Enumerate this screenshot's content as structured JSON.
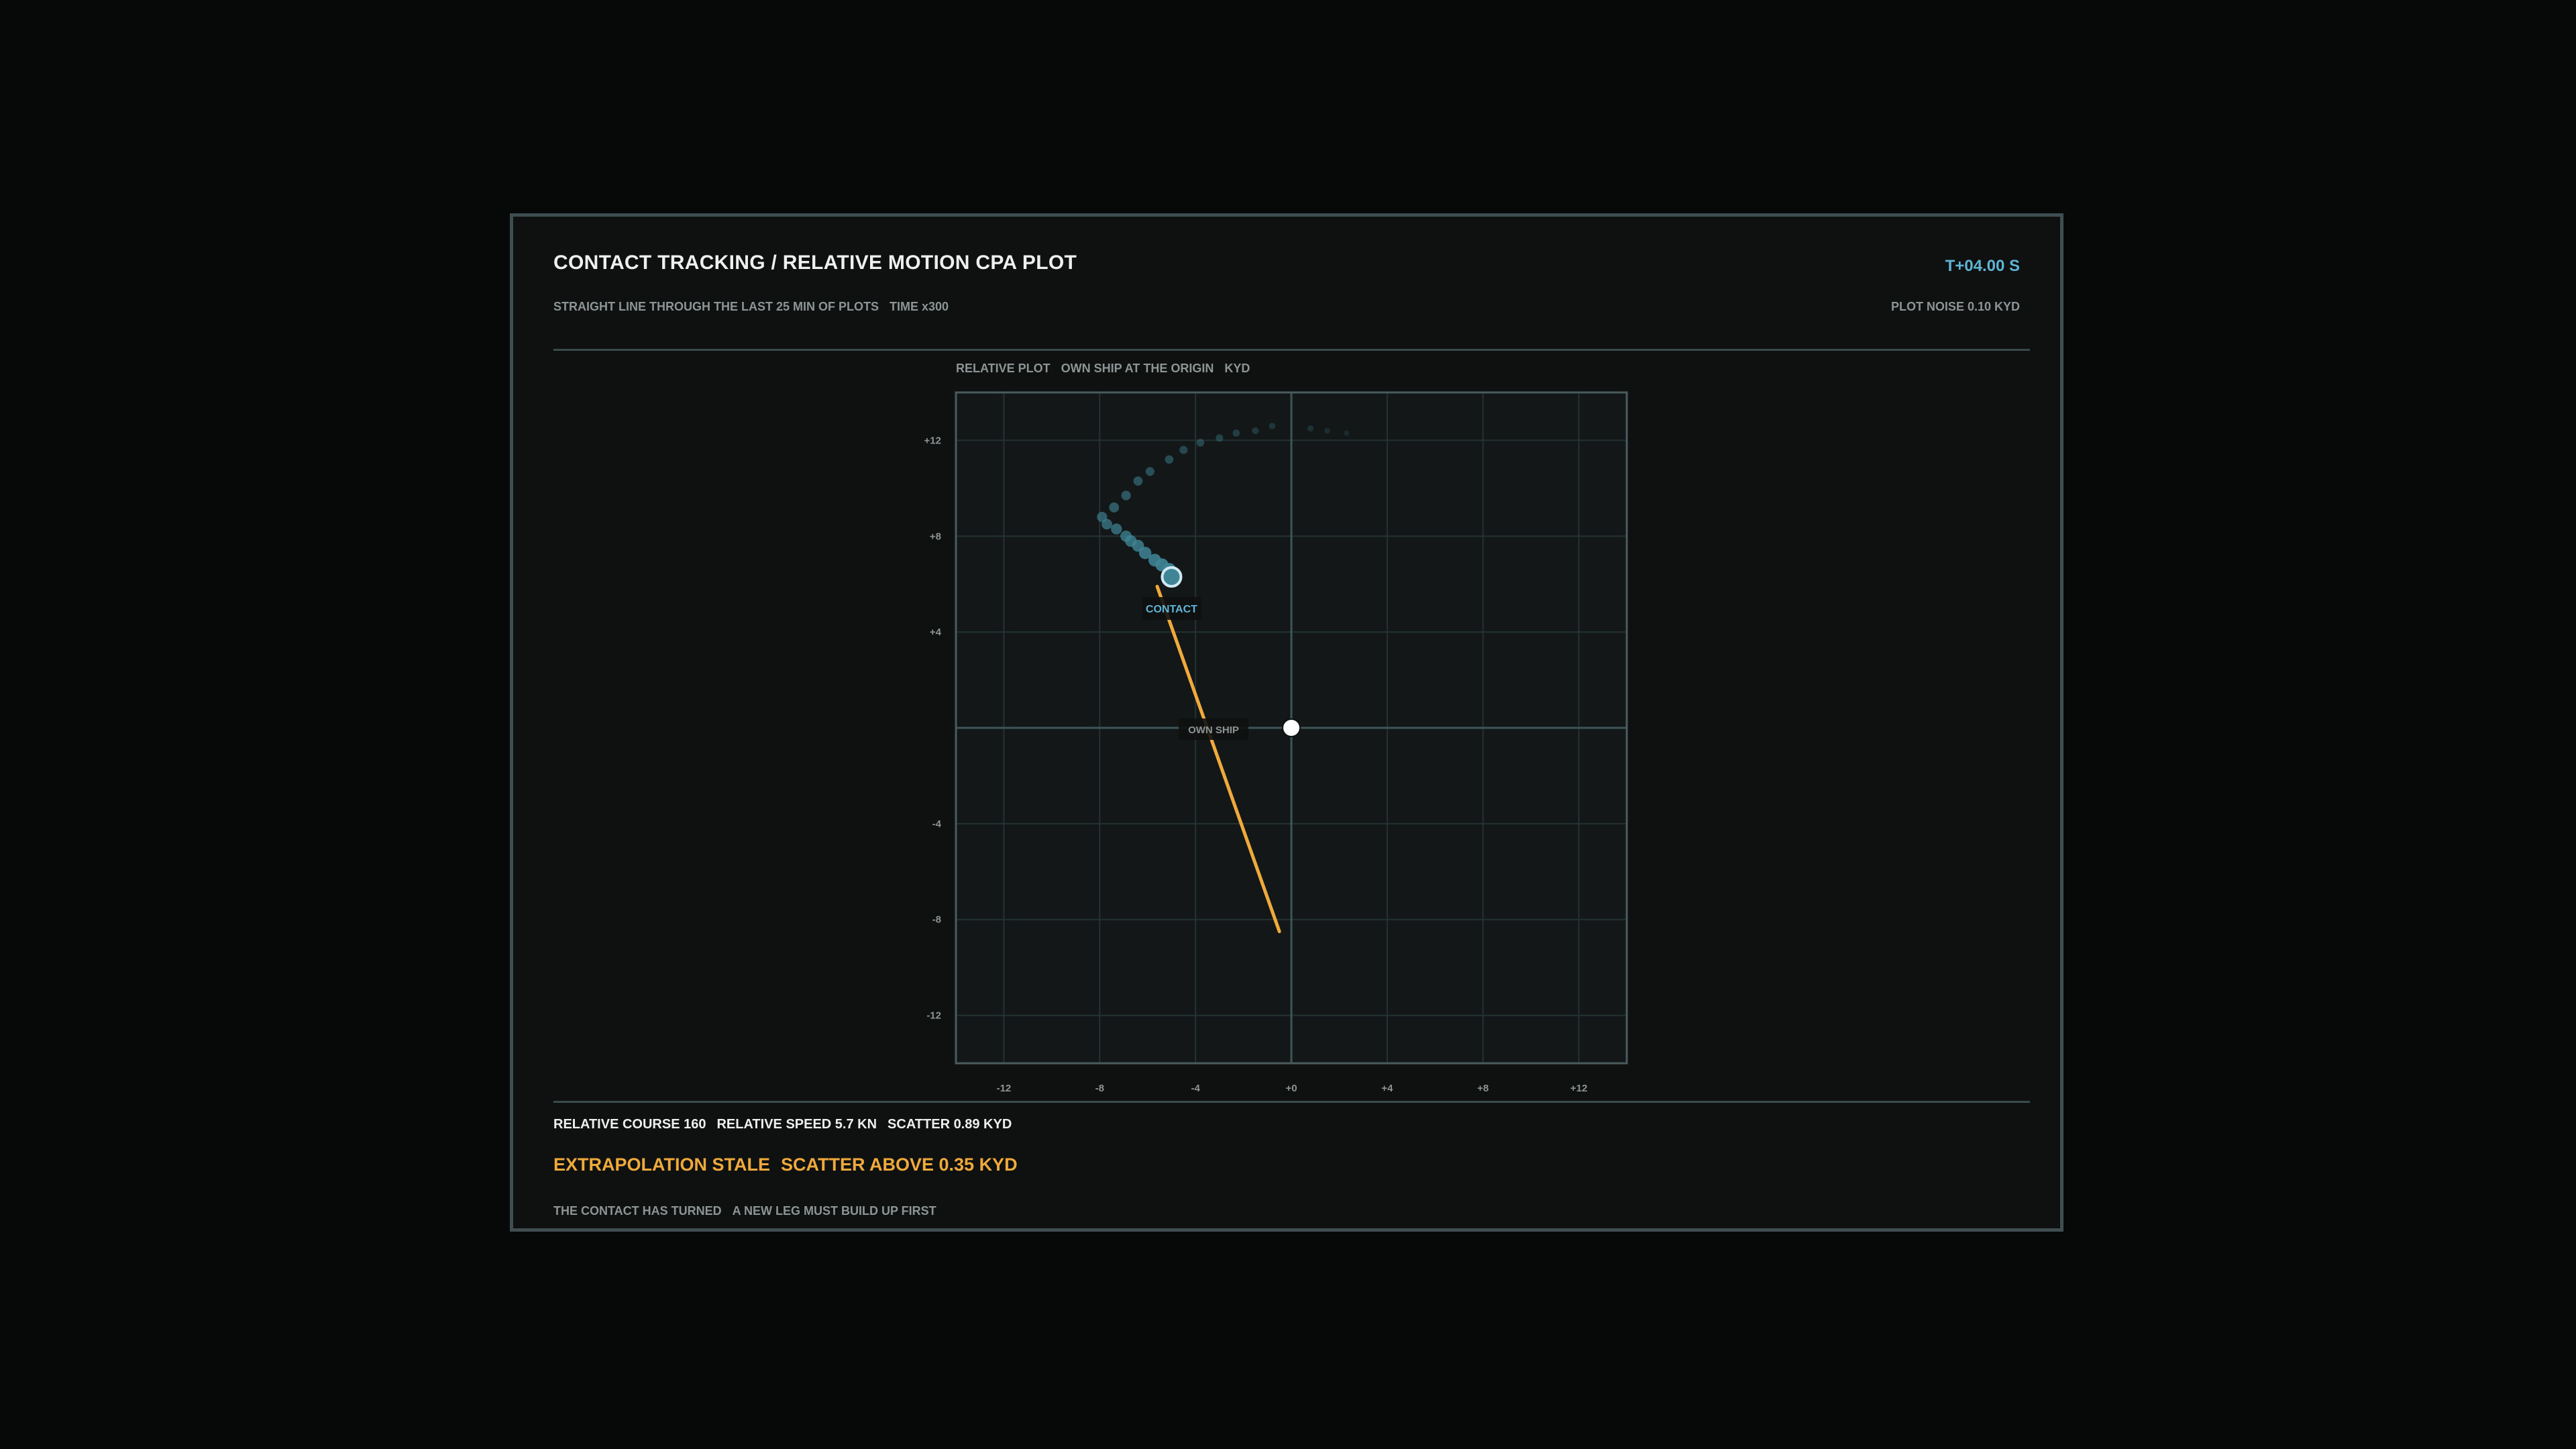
{
  "header": {
    "title": "CONTACT TRACKING / RELATIVE MOTION CPA PLOT",
    "clock": "T+04.00 S",
    "subtitle_a": "STRAIGHT LINE THROUGH THE LAST 25 MIN OF PLOTS",
    "subtitle_b": "TIME x300",
    "noise": "PLOT NOISE 0.10 KYD"
  },
  "plot": {
    "caption_a": "RELATIVE PLOT",
    "caption_b": "OWN SHIP AT THE ORIGIN",
    "caption_c": "KYD"
  },
  "chart_data": {
    "type": "scatter",
    "xlim": [
      -14,
      14
    ],
    "ylim": [
      -14,
      14
    ],
    "x_ticks": [
      "-12",
      "-8",
      "-4",
      "+0",
      "+4",
      "+8",
      "+12"
    ],
    "y_ticks": [
      "+12",
      "+8",
      "+4",
      "-4",
      "-8",
      "-12"
    ],
    "grid": true,
    "history_points": [
      [
        2.3,
        12.3
      ],
      [
        1.5,
        12.4
      ],
      [
        0.8,
        12.5
      ],
      [
        -0.8,
        12.6
      ],
      [
        -1.5,
        12.4
      ],
      [
        -2.3,
        12.3
      ],
      [
        -3.0,
        12.1
      ],
      [
        -3.8,
        11.9
      ],
      [
        -4.5,
        11.6
      ],
      [
        -5.1,
        11.2
      ],
      [
        -5.9,
        10.7
      ],
      [
        -6.4,
        10.3
      ],
      [
        -6.9,
        9.7
      ],
      [
        -7.4,
        9.2
      ],
      [
        -7.9,
        8.8
      ],
      [
        -7.7,
        8.5
      ],
      [
        -7.3,
        8.3
      ],
      [
        -6.9,
        8.0
      ],
      [
        -6.7,
        7.8
      ],
      [
        -6.4,
        7.6
      ],
      [
        -6.1,
        7.3
      ],
      [
        -5.7,
        7.0
      ],
      [
        -5.4,
        6.8
      ],
      [
        -5.1,
        6.6
      ]
    ],
    "contact": {
      "label": "CONTACT",
      "x": -5.0,
      "y": 6.3
    },
    "own_ship": {
      "label": "OWN SHIP",
      "x": 0,
      "y": 0
    },
    "extrapolation": {
      "x1": -5.6,
      "y1": 5.9,
      "x2": -0.5,
      "y2": -8.5
    }
  },
  "status": {
    "course": "RELATIVE COURSE 160",
    "speed": "RELATIVE SPEED 5.7 KN",
    "scatter": "SCATTER 0.89 KYD",
    "alert_a": "EXTRAPOLATION STALE",
    "alert_b": "SCATTER ABOVE 0.35 KYD",
    "note_a": "THE CONTACT HAS TURNED",
    "note_b": "A NEW LEG MUST BUILD UP FIRST"
  },
  "colors": {
    "accent": "#5fb3d4",
    "warning": "#f0aa3b",
    "history": "#3f8596",
    "grid": "#253234",
    "axis": "#3e5658"
  }
}
